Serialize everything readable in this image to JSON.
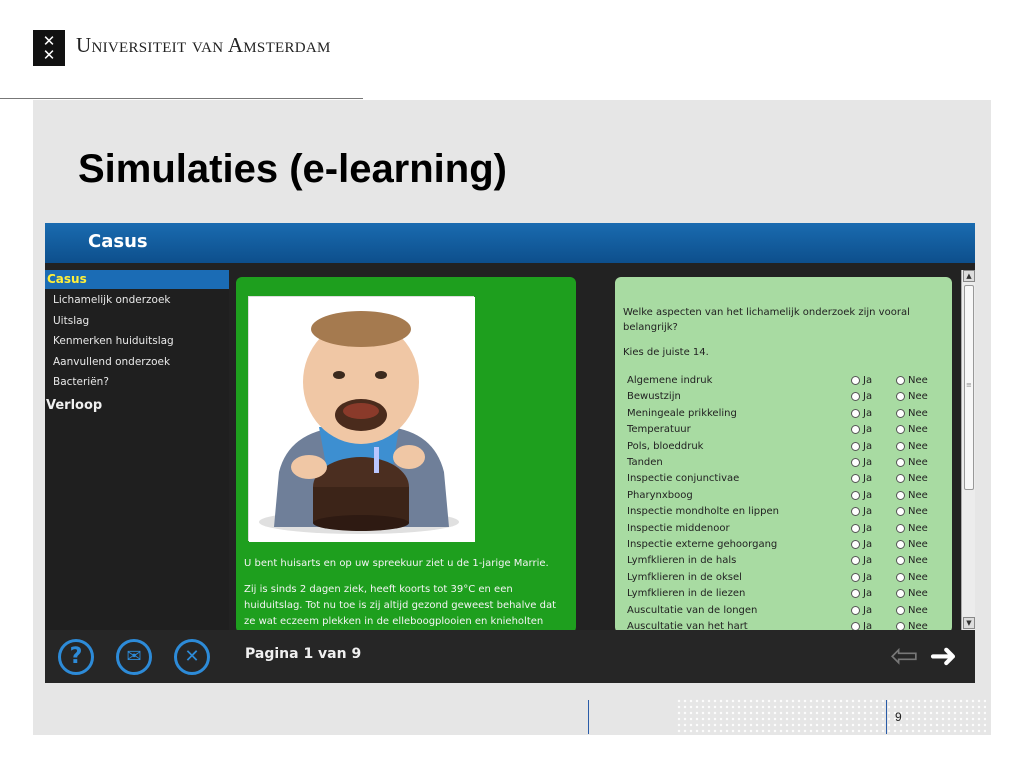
{
  "slide": {
    "university": "Universiteit van Amsterdam",
    "title": "Simulaties (e-learning)",
    "page_number": "9"
  },
  "app": {
    "header_title": "Casus",
    "sidebar": {
      "active": "Casus",
      "items": [
        "Lichamelijk onderzoek",
        "Uitslag",
        "Kenmerken huiduitslag",
        "Aanvullend onderzoek",
        "Bacteriën?"
      ],
      "section2": "Verloop"
    },
    "story": {
      "p1": "U bent huisarts en op uw spreekuur ziet u de 1-jarige Marrie.",
      "p2": "Zij is sinds 2 dagen ziek, heeft koorts tot 39°C en een huiduitslag. Tot nu toe is zij altijd gezond geweest behalve dat ze wat eczeem plekken in de elleboogplooien en knieholten"
    },
    "question": {
      "text": "Welke aspecten van het lichamelijk onderzoek zijn vooral belangrijk?",
      "instruction": "Kies de juiste 14.",
      "yes_label": "Ja",
      "no_label": "Nee",
      "items": [
        "Algemene indruk",
        "Bewustzijn",
        "Meningeale prikkeling",
        "Temperatuur",
        "Pols, bloeddruk",
        "Tanden",
        "Inspectie conjunctivae",
        "Pharynxboog",
        "Inspectie mondholte en lippen",
        "Inspectie middenoor",
        "Inspectie externe gehoorgang",
        "Lymfklieren in de hals",
        "Lymfklieren in de oksel",
        "Lymfklieren in de liezen",
        "Auscultatie van de longen",
        "Auscultatie van het hart"
      ]
    },
    "footer": {
      "page_label": "Pagina 1 van 9",
      "help_icon": "?",
      "mail_icon": "✉",
      "close_icon": "✕",
      "prev_icon": "⇦",
      "next_icon": "➜"
    },
    "colors": {
      "header_blue": "#0d4f8c",
      "active_text": "#ffef3a",
      "green_panel": "#1e9f1e",
      "question_panel": "#a8dba2",
      "button_blue": "#2d8bd8"
    }
  }
}
